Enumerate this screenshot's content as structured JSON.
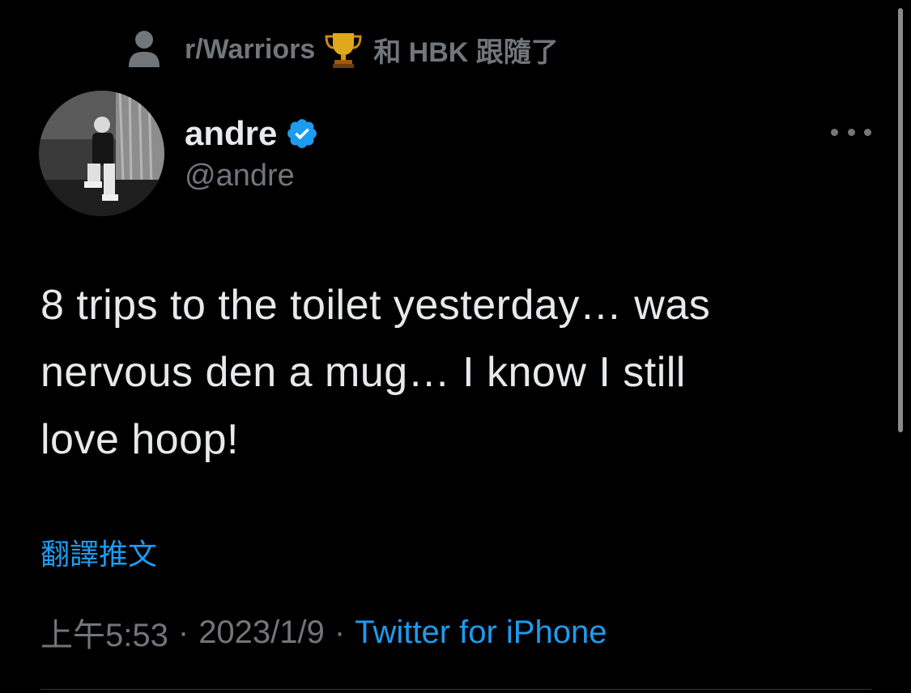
{
  "social_context": {
    "name": "r/Warriors",
    "icon": "trophy-icon",
    "text": "和 HBK 跟隨了"
  },
  "author": {
    "display_name": "andre",
    "handle": "@andre",
    "verified": true,
    "verified_color": "#1d9bf0"
  },
  "tweet": {
    "text_lines": [
      "8 trips to the toilet yesterday… was",
      "nervous den a mug… I know I still",
      "love hoop!"
    ],
    "translate_label": "翻譯推文"
  },
  "meta": {
    "time": "上午5:53",
    "separator": "·",
    "date": "2023/1/9",
    "source": "Twitter for iPhone"
  },
  "colors": {
    "background": "#000000",
    "text": "#e7e9ea",
    "secondary": "#71767b",
    "accent": "#1d9bf0"
  }
}
